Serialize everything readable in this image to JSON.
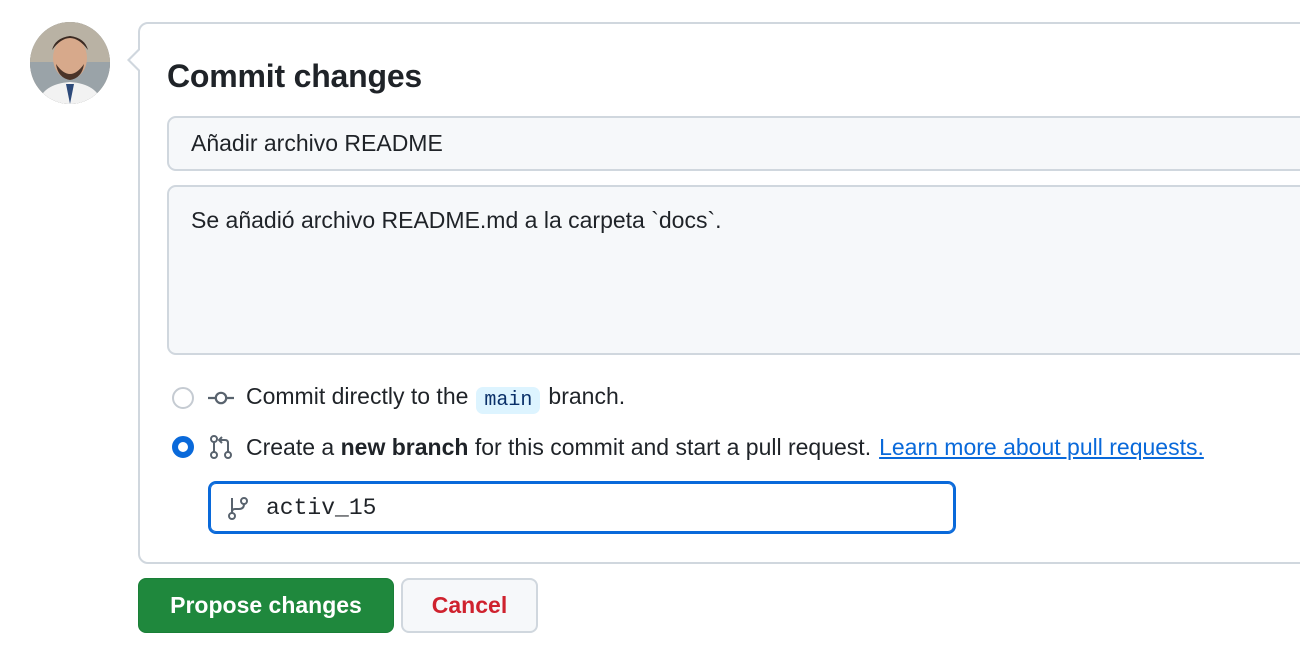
{
  "avatar": {
    "icon": "user-avatar-photo"
  },
  "commit_form": {
    "title": "Commit changes",
    "summary_value": "Añadir archivo README",
    "description_value": "Se añadió archivo README.md a la carpeta `docs`.",
    "options": {
      "direct": {
        "selected": false,
        "icon": "git-commit-icon",
        "prefix": "Commit directly to the",
        "branch": "main",
        "suffix": "branch."
      },
      "new_branch": {
        "selected": true,
        "icon": "git-pull-request-icon",
        "prefix": "Create a",
        "bold": "new branch",
        "suffix": "for this commit and start a pull request.",
        "link": "Learn more about pull requests."
      }
    },
    "branch_name_value": "activ_15"
  },
  "actions": {
    "propose_label": "Propose changes",
    "cancel_label": "Cancel"
  },
  "colors": {
    "primary_green": "#1f883d",
    "link_blue": "#0969da",
    "danger_red": "#cf222e",
    "border": "#d0d7de"
  }
}
